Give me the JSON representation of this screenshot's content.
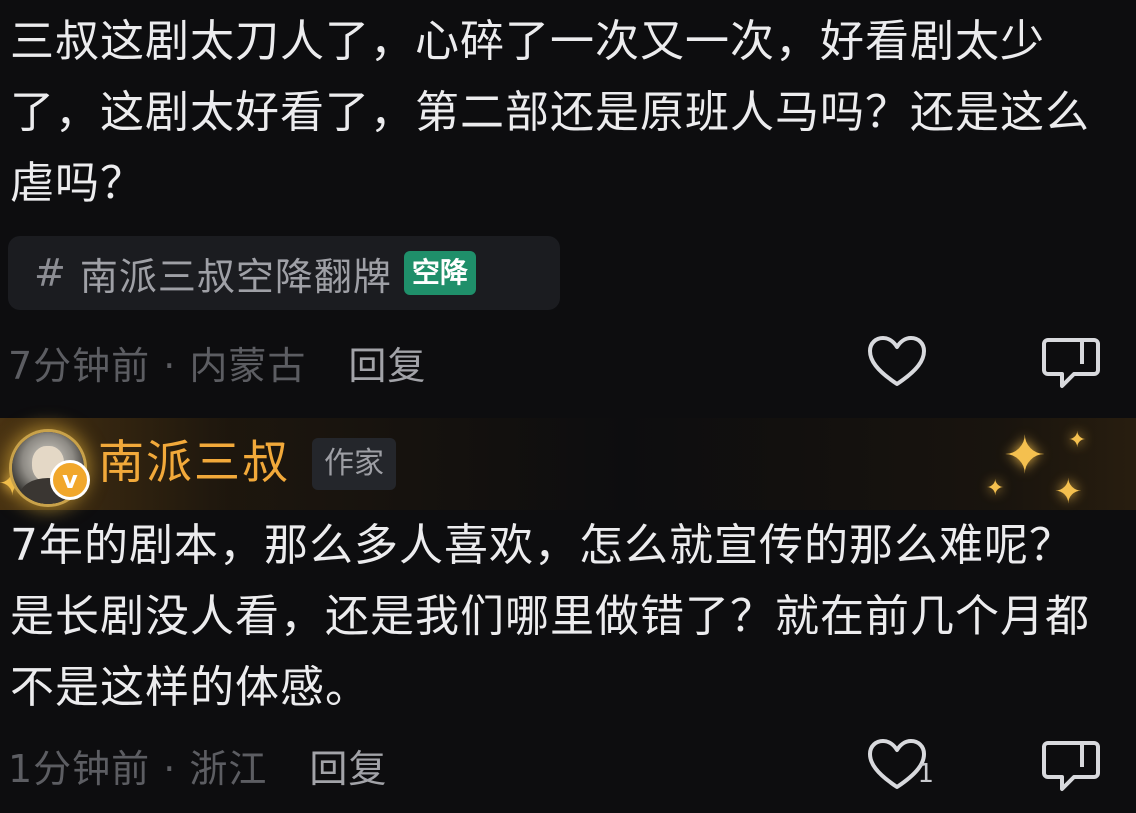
{
  "comment1": {
    "text": "三叔这剧太刀人了，心碎了一次又一次，好看剧太少了，这剧太好看了，第二部还是原班人马吗？还是这么虐吗？",
    "topic": {
      "hash": "#",
      "label": "南派三叔空降翻牌",
      "badge": "空降",
      "badge_color": "#1f8f6a"
    },
    "time_location": "7分钟前 · 内蒙古",
    "reply_label": "回复",
    "like_count": "",
    "icons": {
      "like": "heart-icon",
      "reply": "comment-icon"
    }
  },
  "comment2": {
    "author": {
      "name": "南派三叔",
      "tag": "作家",
      "verified_badge": "v",
      "name_color": "#f2a93a"
    },
    "text": "7年的剧本，那么多人喜欢，怎么就宣传的那么难呢？是长剧没人看，还是我们哪里做错了？就在前几个月都不是这样的体感。",
    "time_location": "1分钟前 · 浙江",
    "reply_label": "回复",
    "like_count": "1",
    "icons": {
      "like": "heart-icon",
      "reply": "comment-icon",
      "decoration": "sparkle-icon"
    }
  }
}
